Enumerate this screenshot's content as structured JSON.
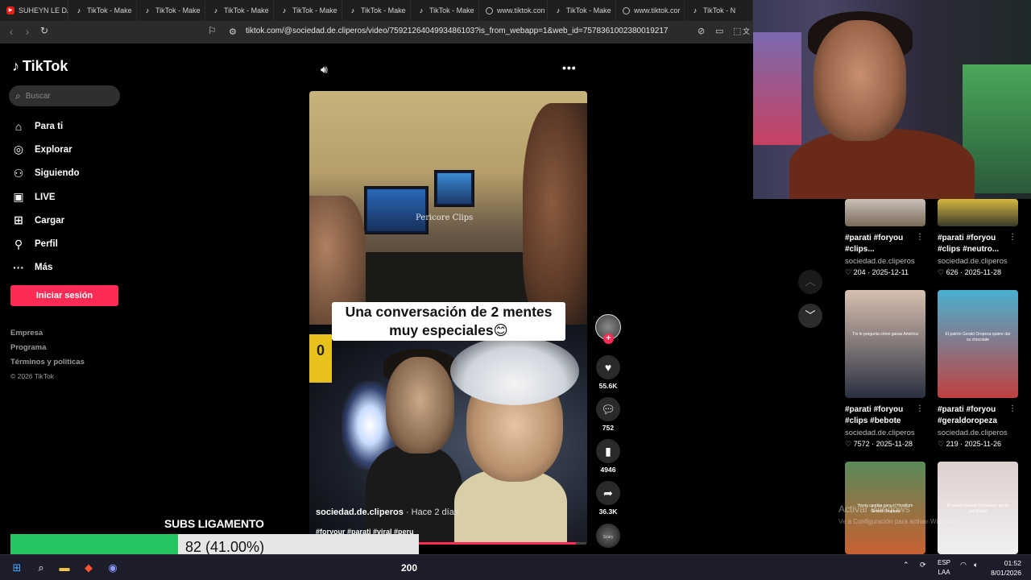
{
  "browser": {
    "tabs": [
      {
        "icon": "youtube-icon",
        "label": "SUHEYN LE DA"
      },
      {
        "icon": "tiktok-icon",
        "label": "TikTok - Make"
      },
      {
        "icon": "tiktok-icon",
        "label": "TikTok - Make"
      },
      {
        "icon": "tiktok-icon",
        "label": "TikTok - Make"
      },
      {
        "icon": "tiktok-icon",
        "label": "TikTok - Make"
      },
      {
        "icon": "tiktok-icon",
        "label": "TikTok - Make"
      },
      {
        "icon": "tiktok-icon",
        "label": "TikTok - Make"
      },
      {
        "icon": "globe-icon",
        "label": "www.tiktok.con"
      },
      {
        "icon": "tiktok-icon",
        "label": "TikTok - Make"
      },
      {
        "icon": "globe-icon",
        "label": "www.tiktok.cor"
      },
      {
        "icon": "tiktok-icon",
        "label": "TikTok - N"
      }
    ],
    "url": "tiktok.com/@sociedad.de.cliperos/video/7592126404993486103?is_from_webapp=1&web_id=7578361002380019217"
  },
  "sidebar": {
    "logo": "TikTok",
    "search_placeholder": "Buscar",
    "nav": [
      {
        "icon": "home-icon",
        "label": "Para ti"
      },
      {
        "icon": "compass-icon",
        "label": "Explorar"
      },
      {
        "icon": "following-icon",
        "label": "Siguiendo"
      },
      {
        "icon": "live-icon",
        "label": "LIVE"
      },
      {
        "icon": "upload-icon",
        "label": "Cargar"
      },
      {
        "icon": "profile-icon",
        "label": "Perfil"
      },
      {
        "icon": "more-icon",
        "label": "Más"
      }
    ],
    "login_label": "Iniciar sesión",
    "footer": [
      "Empresa",
      "Programa",
      "Términos y políticas"
    ],
    "copyright": "© 2026 TikTok"
  },
  "video": {
    "watermark": "Pericore Clips",
    "caption": "Una conversación de 2 mentes muy especiales😊",
    "author": "sociedad.de.cliperos",
    "posted": "· Hace 2 días",
    "hashtags": "#foryour #parati #viral #peru",
    "badge_text": "0",
    "progress": 0.96,
    "likes": "55.6K",
    "comments": "752",
    "saves": "4946",
    "shares": "36.3K",
    "music_label": "Scary"
  },
  "feed": {
    "cards": [
      {
        "title": "#parati #foryou #clips...",
        "handle": "sociedad.de.cliperos",
        "likes": "204",
        "date": "2025-12-11",
        "thumb": "linear-gradient(180deg,#c9c1b8,#7a6a5a)",
        "label": ""
      },
      {
        "title": "#parati #foryou #clips #neutro...",
        "handle": "sociedad.de.cliperos",
        "likes": "626",
        "date": "2025-11-28",
        "thumb": "linear-gradient(180deg,#d4b840,#3a3a2a)",
        "label": ""
      },
      {
        "title": "#parati #foryou #clips #bebote",
        "handle": "sociedad.de.cliperos",
        "likes": "7572",
        "date": "2025-11-28",
        "thumb": "linear-gradient(180deg,#d8c0b0,#2a3040)",
        "label": "Tío le pregunta cómo ganas América"
      },
      {
        "title": "#parati #foryou #geraldoropeza",
        "handle": "sociedad.de.cliperos",
        "likes": "219",
        "date": "2025-11-26",
        "thumb": "linear-gradient(180deg,#4ab0d0,#c04040)",
        "label": "El patrón Gerald Oropeza quiere dar su chocolate"
      },
      {
        "title": "",
        "handle": "",
        "likes": "",
        "date": "",
        "thumb": "linear-gradient(180deg,#5a8a5a,#c86030)",
        "label": "Hasta cambia para el Hoodlum Gerald Oropeza"
      },
      {
        "title": "",
        "handle": "",
        "likes": "",
        "date": "",
        "thumb": "linear-gradient(180deg,#e0d0d0,#f0f0f0)",
        "label": "El patrón Gerald Oropeza le gusta ser Doctor"
      }
    ],
    "windows_watermark": "Activar Windows",
    "windows_watermark_sub": "Ve a Configuración para activar Windows."
  },
  "overlay": {
    "subs_title": "SUBS LIGAMENTO",
    "subs_value": "82 (41.00%)",
    "subs_fraction": 0.41,
    "bar_color": "#22c55e"
  },
  "taskbar": {
    "count": "200",
    "lang1": "ESP",
    "lang2": "LAA",
    "time": "01:52",
    "date": "8/01/2026"
  }
}
